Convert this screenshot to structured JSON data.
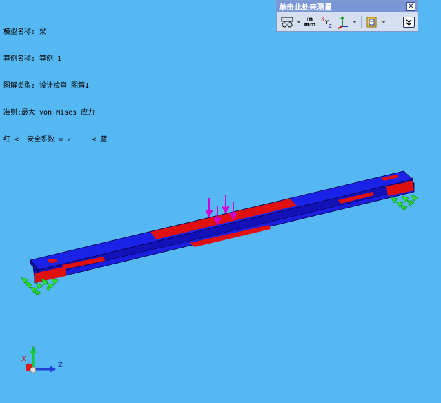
{
  "info": {
    "model_name": "模型名称: 梁",
    "study_name": "算例名称: 算例 1",
    "plot_type": "图解类型: 设计检查 图解1",
    "criterion": "准则:最大 von Mises 应力",
    "legend_text": "红 <  安全系数 = 2     < 蓝"
  },
  "measure_toolbar": {
    "title": "单击此处来测量",
    "close_glyph": "✕",
    "units_label_top": "in",
    "units_label_bottom": "mm"
  },
  "triad": {
    "x_label": "X",
    "y_label": "Y",
    "z_label": "Z"
  },
  "colors": {
    "background": "#55b8f3",
    "unsafe_region": "#e0100e",
    "safe_region": "#1a1ee0",
    "load_arrow": "#d000d8",
    "fixture": "#2ee02e"
  }
}
